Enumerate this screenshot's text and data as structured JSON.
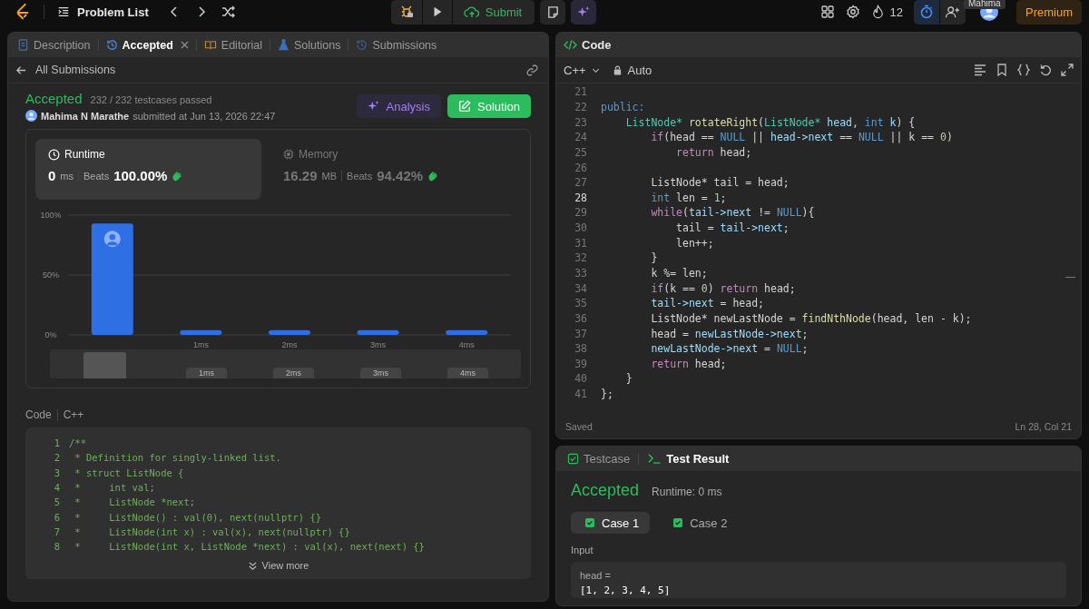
{
  "top_bar": {
    "title": "Problem List",
    "submit": "Submit",
    "streak": "12",
    "timer_active": true,
    "tooltip": "Mahima",
    "premium": "Premium"
  },
  "left_panel": {
    "tabs": [
      {
        "kind": "description",
        "label": "Description",
        "selected": false,
        "closable": false
      },
      {
        "kind": "history",
        "label": "Accepted",
        "selected": true,
        "closable": true
      },
      {
        "kind": "book",
        "label": "Editorial",
        "selected": false,
        "closable": false
      },
      {
        "kind": "flask",
        "label": "Solutions",
        "selected": false,
        "closable": false
      },
      {
        "kind": "history",
        "label": "Submissions",
        "selected": false,
        "closable": false
      }
    ],
    "back_link": "All Submissions",
    "submission": {
      "status": "Accepted",
      "testcases": "232 / 232 testcases passed",
      "author": "Mahima N Marathe",
      "submitted": "submitted at Jun 13, 2026 22:47",
      "analysis": "Analysis",
      "solution": "Solution"
    },
    "stats": [
      {
        "kind": "clock",
        "label": "Runtime",
        "value": "0",
        "unit": "ms",
        "beats_label": "Beats",
        "beats": "100.00%",
        "selected": true
      },
      {
        "kind": "chip",
        "label": "Memory",
        "value": "16.29",
        "unit": "MB",
        "beats_label": "Beats",
        "beats": "94.42%",
        "selected": false
      }
    ],
    "runtime_chart": {
      "chart_data": {
        "type": "bar",
        "x": [
          0,
          1,
          2,
          3,
          4
        ],
        "values": [
          93,
          4,
          4,
          4,
          4
        ],
        "xlim": [
          -0.5,
          4.5
        ],
        "ylim": [
          0,
          100
        ],
        "yticks": [
          {
            "value": 0,
            "label": "0%"
          },
          {
            "value": 50,
            "label": "50%"
          },
          {
            "value": 100,
            "label": "100%"
          }
        ],
        "xticks": [
          {
            "value": 1,
            "label": "1ms"
          },
          {
            "value": 2,
            "label": "2ms"
          },
          {
            "value": 3,
            "label": "3ms"
          },
          {
            "value": 4,
            "label": "4ms"
          }
        ]
      },
      "navigator_labels": [
        "1ms",
        "2ms",
        "3ms",
        "4ms"
      ]
    },
    "code": {
      "label": "Code",
      "language": "C++",
      "view_more": "View more",
      "lines": [
        {
          "number": "1",
          "text": "/**"
        },
        {
          "number": "2",
          "text": " * Definition for singly-linked list."
        },
        {
          "number": "3",
          "text": " * struct ListNode {"
        },
        {
          "number": "4",
          "text": " *     int val;"
        },
        {
          "number": "5",
          "text": " *     ListNode *next;"
        },
        {
          "number": "6",
          "text": " *     ListNode() : val(0), next(nullptr) {}"
        },
        {
          "number": "7",
          "text": " *     ListNode(int x) : val(x), next(nullptr) {}"
        },
        {
          "number": "8",
          "text": " *     ListNode(int x, ListNode *next) : val(x), next(next) {}"
        }
      ]
    }
  },
  "editor": {
    "title": "Code",
    "language": "C++",
    "mode": "Auto",
    "status": "Saved",
    "cursor": "Ln 28, Col 21",
    "lines": [
      {
        "number": "21",
        "current": false
      },
      {
        "number": "22",
        "current": false,
        "tokens": [
          {
            "kind": "kw",
            "text": "public:"
          }
        ]
      },
      {
        "number": "23",
        "current": false,
        "tokens": [
          {
            "kind": "type",
            "text": "    ListNode*"
          },
          {
            "kind": "fn",
            "text": " rotateRight"
          },
          {
            "kind": "plain",
            "text": "("
          },
          {
            "kind": "type",
            "text": "ListNode*"
          },
          {
            "kind": "var",
            "text": " head"
          },
          {
            "kind": "plain",
            "text": ", "
          },
          {
            "kind": "kw",
            "text": "int"
          },
          {
            "kind": "var",
            "text": " k"
          },
          {
            "kind": "plain",
            "text": ") {"
          }
        ]
      },
      {
        "number": "24",
        "current": false,
        "tokens": [
          {
            "kind": "ctl",
            "text": "        if"
          },
          {
            "kind": "plain",
            "text": "(head == "
          },
          {
            "kind": "kw",
            "text": "NULL"
          },
          {
            "kind": "plain",
            "text": " || "
          },
          {
            "kind": "var",
            "text": "head->next"
          },
          {
            "kind": "plain",
            "text": " == "
          },
          {
            "kind": "kw",
            "text": "NULL"
          },
          {
            "kind": "plain",
            "text": " || k == "
          },
          {
            "kind": "num",
            "text": "0"
          },
          {
            "kind": "plain",
            "text": ")"
          }
        ]
      },
      {
        "number": "25",
        "current": false,
        "tokens": [
          {
            "kind": "ctl",
            "text": "            return"
          },
          {
            "kind": "plain",
            "text": " head;"
          }
        ]
      },
      {
        "number": "26",
        "current": false
      },
      {
        "number": "27",
        "current": false,
        "tokens": [
          {
            "kind": "plain",
            "text": "        ListNode* tail = head;"
          }
        ]
      },
      {
        "number": "28",
        "current": true,
        "tokens": [
          {
            "kind": "kw",
            "text": "        int"
          },
          {
            "kind": "plain",
            "text": " len = "
          },
          {
            "kind": "num",
            "text": "1"
          },
          {
            "kind": "plain",
            "text": ";"
          }
        ]
      },
      {
        "number": "29",
        "current": false,
        "tokens": [
          {
            "kind": "ctl",
            "text": "        while"
          },
          {
            "kind": "plain",
            "text": "("
          },
          {
            "kind": "var",
            "text": "tail->next"
          },
          {
            "kind": "plain",
            "text": " != "
          },
          {
            "kind": "kw",
            "text": "NULL"
          },
          {
            "kind": "plain",
            "text": "){"
          }
        ]
      },
      {
        "number": "30",
        "current": false,
        "tokens": [
          {
            "kind": "plain",
            "text": "            tail = "
          },
          {
            "kind": "var",
            "text": "tail->next"
          },
          {
            "kind": "plain",
            "text": ";"
          }
        ]
      },
      {
        "number": "31",
        "current": false,
        "tokens": [
          {
            "kind": "plain",
            "text": "            len++;"
          }
        ]
      },
      {
        "number": "32",
        "current": false,
        "tokens": [
          {
            "kind": "plain",
            "text": "        }"
          }
        ]
      },
      {
        "number": "33",
        "current": false,
        "tokens": [
          {
            "kind": "plain",
            "text": "        k %= len;"
          }
        ]
      },
      {
        "number": "34",
        "current": false,
        "tokens": [
          {
            "kind": "ctl",
            "text": "        if"
          },
          {
            "kind": "plain",
            "text": "(k == "
          },
          {
            "kind": "num",
            "text": "0"
          },
          {
            "kind": "plain",
            "text": ") "
          },
          {
            "kind": "ctl",
            "text": "return"
          },
          {
            "kind": "plain",
            "text": " head;"
          }
        ]
      },
      {
        "number": "35",
        "current": false,
        "tokens": [
          {
            "kind": "var",
            "text": "        tail->next"
          },
          {
            "kind": "plain",
            "text": " = head;"
          }
        ]
      },
      {
        "number": "36",
        "current": false,
        "tokens": [
          {
            "kind": "plain",
            "text": "        ListNode* newLastNode = "
          },
          {
            "kind": "fn",
            "text": "findNthNode"
          },
          {
            "kind": "plain",
            "text": "(head, len - k);"
          }
        ]
      },
      {
        "number": "37",
        "current": false,
        "tokens": [
          {
            "kind": "plain",
            "text": "        head = "
          },
          {
            "kind": "var",
            "text": "newLastNode->next"
          },
          {
            "kind": "plain",
            "text": ";"
          }
        ]
      },
      {
        "number": "38",
        "current": false,
        "tokens": [
          {
            "kind": "var",
            "text": "        newLastNode->next"
          },
          {
            "kind": "plain",
            "text": " = "
          },
          {
            "kind": "kw",
            "text": "NULL"
          },
          {
            "kind": "plain",
            "text": ";"
          }
        ]
      },
      {
        "number": "39",
        "current": false,
        "tokens": [
          {
            "kind": "ctl",
            "text": "        return"
          },
          {
            "kind": "plain",
            "text": " head;"
          }
        ]
      },
      {
        "number": "40",
        "current": false,
        "tokens": [
          {
            "kind": "plain",
            "text": "    }"
          }
        ]
      },
      {
        "number": "41",
        "current": false,
        "tokens": [
          {
            "kind": "plain",
            "text": "};"
          }
        ]
      }
    ]
  },
  "result_panel": {
    "tabs": [
      {
        "kind": "check",
        "label": "Testcase",
        "selected": false
      },
      {
        "kind": "terminal",
        "label": "Test Result",
        "selected": true
      }
    ],
    "verdict": "Accepted",
    "runtime": "Runtime: 0 ms",
    "cases": [
      {
        "label": "Case 1",
        "selected": true
      },
      {
        "label": "Case 2",
        "selected": false
      }
    ],
    "input_label": "Input",
    "param": "head =",
    "value": "[1, 2, 3, 4, 5]"
  }
}
